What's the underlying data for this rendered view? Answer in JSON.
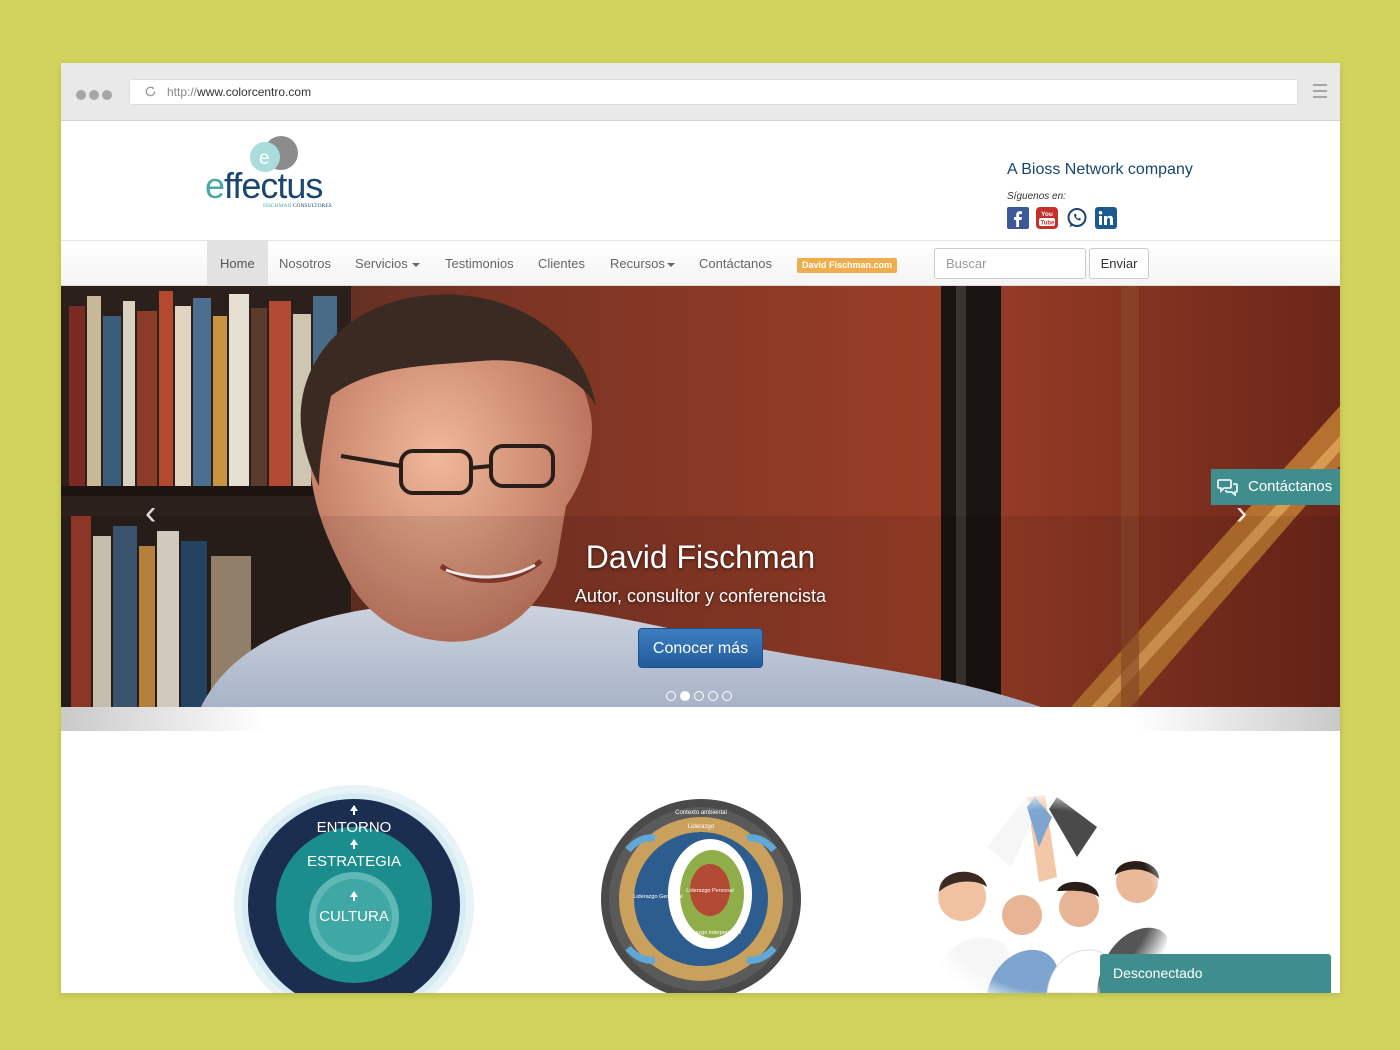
{
  "browser": {
    "url_protocol": "http://",
    "url_host": "www.colorcentro.com"
  },
  "header": {
    "logo_word": "ffectus",
    "logo_letter": "e",
    "logo_sub_brand": "FISCHMAN",
    "logo_sub_text": "CONSULTORES",
    "company_tagline": "A Bioss Network company",
    "follow_label": "Síguenos en:",
    "social_icons": [
      "facebook-icon",
      "youtube-icon",
      "whatsapp-icon",
      "linkedin-icon"
    ]
  },
  "nav": {
    "items": [
      {
        "label": "Home",
        "active": true
      },
      {
        "label": "Nosotros"
      },
      {
        "label": "Servicios",
        "dropdown": true
      },
      {
        "label": "Testimonios"
      },
      {
        "label": "Clientes"
      },
      {
        "label": "Recursos",
        "dropdown": true
      },
      {
        "label": "Contáctanos"
      }
    ],
    "badge": "David Fischman.com",
    "search_placeholder": "Buscar",
    "search_button": "Enviar"
  },
  "hero": {
    "title": "David Fischman",
    "subtitle": "Autor, consultor y conferencista",
    "cta": "Conocer más",
    "slide_count": 5,
    "active_slide": 2
  },
  "contact_tab": {
    "label": "Contáctanos"
  },
  "features": {
    "culture_circle": [
      "ENTORNO",
      "ESTRATEGIA",
      "CULTURA"
    ],
    "leadership_circle": [
      "Contexto ambiental",
      "Liderazgo",
      "Liderazgo Gerencial",
      "Liderazgo Personal",
      "Liderazgo Interpersonal"
    ]
  },
  "chat_widget": {
    "status": "Desconectado"
  },
  "colors": {
    "page_bg": "#d1d35c",
    "brand_navy": "#1b4670",
    "brand_teal": "#4aa9a7",
    "accent_teal": "#3f8e8d",
    "badge_orange": "#f0ad4e",
    "cta_blue": "#2d6cab"
  }
}
